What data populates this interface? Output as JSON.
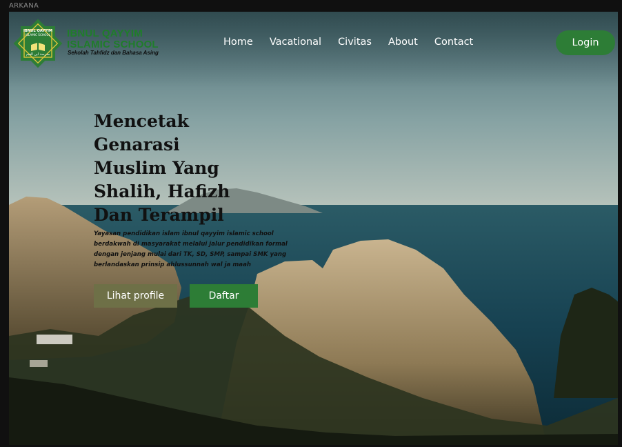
{
  "window": {
    "label": "ARKANA"
  },
  "brand": {
    "name_line1": "IBNUL QAYYIM",
    "name_line2": "ISLAMIC SCHOOL",
    "tagline": "Sekolah Tahfidz dan Bahasa Asing",
    "logo_text_top": "IBNUL QAYYIM",
    "logo_text_mid": "ISLAMIC SCHOOL",
    "logo_text_bottom": "مدرسة ابن القيم"
  },
  "nav": {
    "items": [
      {
        "label": "Home"
      },
      {
        "label": "Vacational"
      },
      {
        "label": "Civitas"
      },
      {
        "label": "About"
      },
      {
        "label": "Contact"
      }
    ],
    "login_label": "Login"
  },
  "hero": {
    "title": "Mencetak Genarasi Muslim Yang Shalih, Hafizh Dan Terampil",
    "description": "Yayasan pendidikan islam ibnul qayyim islamic school berdakwah di masyarakat melalui jalur pendidikan formal dengan jenjang mulai dari TK, SD, SMP, sampai SMK yang berlandaskan prinsip ahlussunnah wal ja maah",
    "profile_button": "Lihat profile",
    "register_button": "Daftar"
  },
  "colors": {
    "primary_green": "#2d7d36",
    "olive": "#6e7047",
    "brand_green": "#1f7d2a",
    "sea": "#1f4c59"
  }
}
